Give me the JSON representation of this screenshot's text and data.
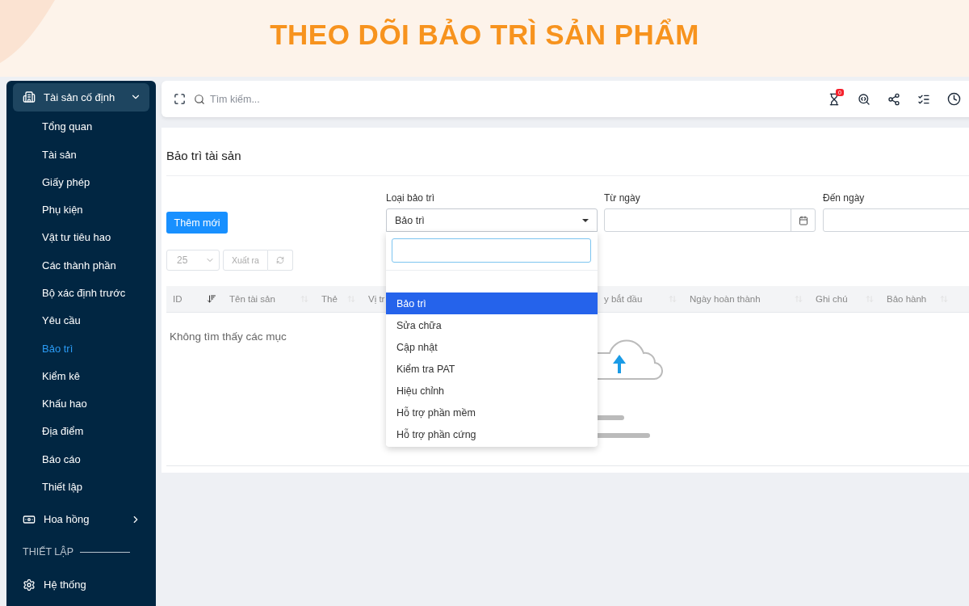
{
  "banner": {
    "title": "THEO DÕI BẢO TRÌ SẢN PHẨM"
  },
  "sidebar": {
    "groups": [
      {
        "label": "Tài sản cố định",
        "kind": "building",
        "expanded": true,
        "children": [
          {
            "label": "Tổng quan",
            "selected": false
          },
          {
            "label": "Tài sản",
            "selected": false
          },
          {
            "label": "Giấy phép",
            "selected": false
          },
          {
            "label": "Phụ kiện",
            "selected": false
          },
          {
            "label": "Vật tư tiêu hao",
            "selected": false
          },
          {
            "label": "Các thành phần",
            "selected": false
          },
          {
            "label": "Bộ xác định trước",
            "selected": false
          },
          {
            "label": "Yêu cầu",
            "selected": false
          },
          {
            "label": "Bảo trì",
            "selected": true
          },
          {
            "label": "Kiểm kê",
            "selected": false
          },
          {
            "label": "Khấu hao",
            "selected": false
          },
          {
            "label": "Địa điểm",
            "selected": false
          },
          {
            "label": "Báo cáo",
            "selected": false
          },
          {
            "label": "Thiết lập",
            "selected": false
          }
        ]
      },
      {
        "label": "Hoa hồng",
        "kind": "money",
        "expanded": false
      }
    ],
    "section": "THIẾT LẬP",
    "bottom_items": [
      {
        "label": "Hệ thống",
        "kind": "gear"
      }
    ]
  },
  "topbar": {
    "search": {
      "placeholder": "Tìm kiếm..."
    },
    "badge": "0"
  },
  "page": {
    "title": "Bảo trì tài sản",
    "add_button": "Thêm mới",
    "maintenance_type": {
      "label": "Loại bảo trì",
      "value": "Bảo trì",
      "expanded": true
    },
    "from_date": {
      "label": "Từ ngày"
    },
    "to_date": {
      "label": "Đến ngày"
    },
    "page_size": "25",
    "export_button": "Xuất ra",
    "columns": [
      {
        "label": "ID",
        "sorted": true
      },
      {
        "label": "Tên tài sản",
        "sorted": false
      },
      {
        "label": "Thẻ",
        "sorted": false
      },
      {
        "label": "Vị tr"
      },
      {
        "label": "y bắt đầu",
        "sorted": false
      },
      {
        "label": "Ngày hoàn thành",
        "sorted": false
      },
      {
        "label": "Ghi chú",
        "sorted": false
      },
      {
        "label": "Bảo hành",
        "sorted": false
      }
    ],
    "empty_message": "Không tìm thấy các mục",
    "dropdown": {
      "options": [
        {
          "label": "Bảo trì",
          "selected": true
        },
        {
          "label": "Sửa chữa",
          "selected": false
        },
        {
          "label": "Cập nhật",
          "selected": false
        },
        {
          "label": "Kiểm tra PAT",
          "selected": false
        },
        {
          "label": "Hiệu chỉnh",
          "selected": false
        },
        {
          "label": "Hỗ trợ phần mềm",
          "selected": false
        },
        {
          "label": "Hỗ trợ phần cứng",
          "selected": false
        }
      ]
    }
  }
}
